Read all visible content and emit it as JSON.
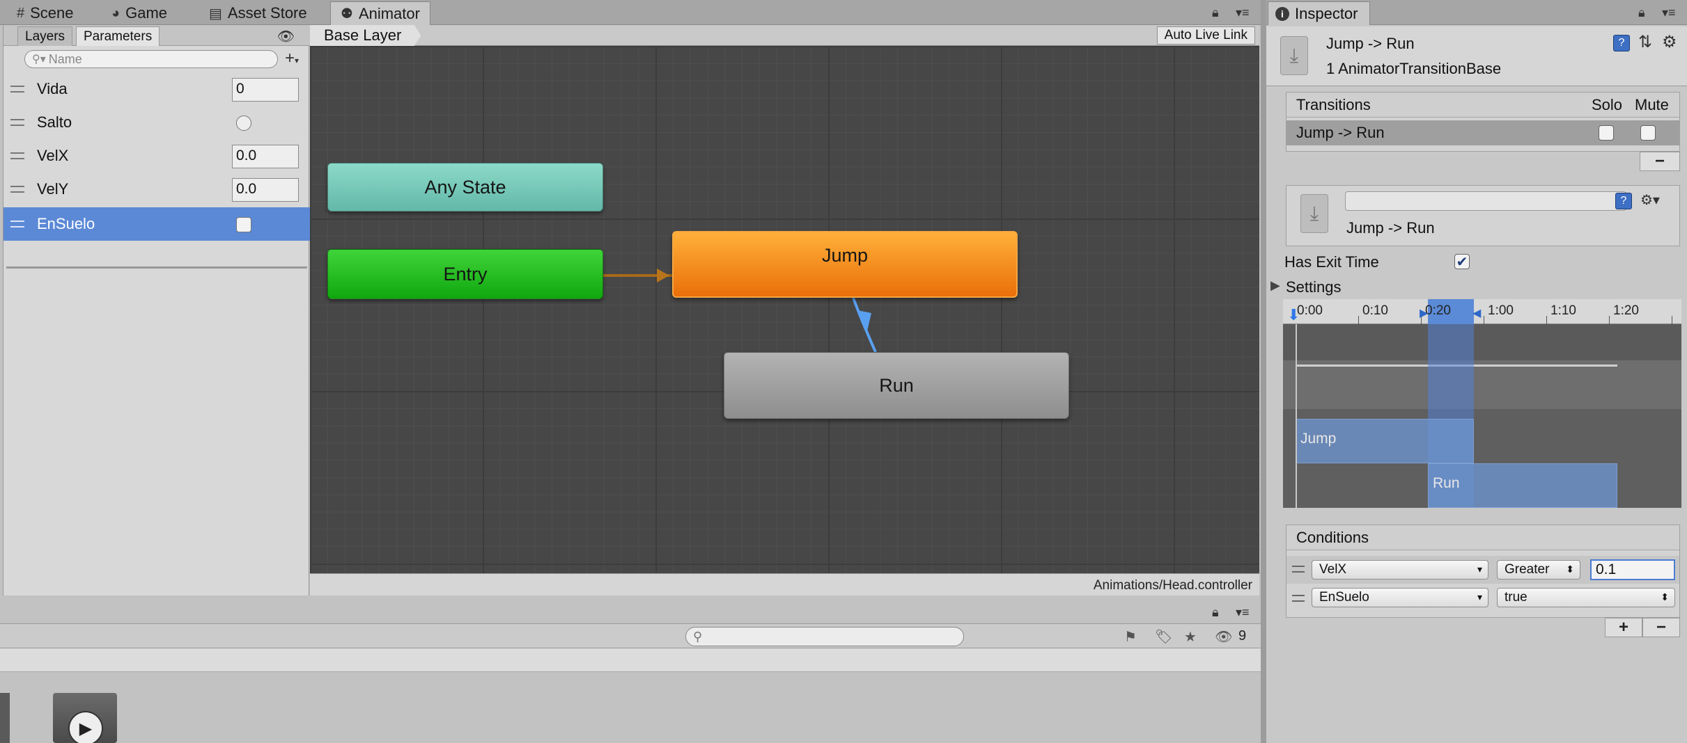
{
  "tabs": [
    {
      "label": "Scene",
      "icon": "grid-icon"
    },
    {
      "label": "Game",
      "icon": "pacman-icon"
    },
    {
      "label": "Asset Store",
      "icon": "store-icon"
    },
    {
      "label": "Animator",
      "icon": "animator-icon"
    }
  ],
  "animator": {
    "subtabs": {
      "layers": "Layers",
      "parameters": "Parameters"
    },
    "search_placeholder": "Name",
    "parameters": [
      {
        "name": "Vida",
        "type": "int",
        "value": "0"
      },
      {
        "name": "Salto",
        "type": "trigger",
        "value": ""
      },
      {
        "name": "VelX",
        "type": "float",
        "value": "0.0"
      },
      {
        "name": "VelY",
        "type": "float",
        "value": "0.0"
      },
      {
        "name": "EnSuelo",
        "type": "bool",
        "value": ""
      }
    ],
    "selected_parameter": "EnSuelo",
    "breadcrumb": "Base Layer",
    "auto_live_link": "Auto Live Link",
    "states": {
      "any_state": "Any State",
      "entry": "Entry",
      "jump": "Jump",
      "run": "Run"
    },
    "controller_path": "Animations/Head.controller"
  },
  "bottom_pane": {
    "hidden_count": "9"
  },
  "inspector": {
    "tab": "Inspector",
    "title": "Jump -> Run",
    "subtitle": "1 AnimatorTransitionBase",
    "transitions": {
      "header": "Transitions",
      "solo": "Solo",
      "mute": "Mute",
      "rows": [
        {
          "label": "Jump -> Run",
          "solo": false,
          "mute": false
        }
      ]
    },
    "transition_name": "Jump -> Run",
    "has_exit_time": {
      "label": "Has Exit Time",
      "checked": true
    },
    "settings_label": "Settings",
    "timeline": {
      "ticks": [
        "0:00",
        "0:10",
        "0:20",
        "1:00",
        "1:10",
        "1:20"
      ],
      "source_clip": "Jump",
      "dest_clip": "Run"
    },
    "conditions": {
      "header": "Conditions",
      "rows": [
        {
          "parameter": "VelX",
          "mode": "Greater",
          "value": "0.1"
        },
        {
          "parameter": "EnSuelo",
          "mode": "true",
          "value": ""
        }
      ]
    }
  },
  "colors": {
    "any_state": "#6ec8b6",
    "entry": "#22c11f",
    "jump": "#f08a1c",
    "run": "#a0a0a0",
    "selection": "#5b89d6",
    "transition_arrow": "#5aa0f0"
  }
}
